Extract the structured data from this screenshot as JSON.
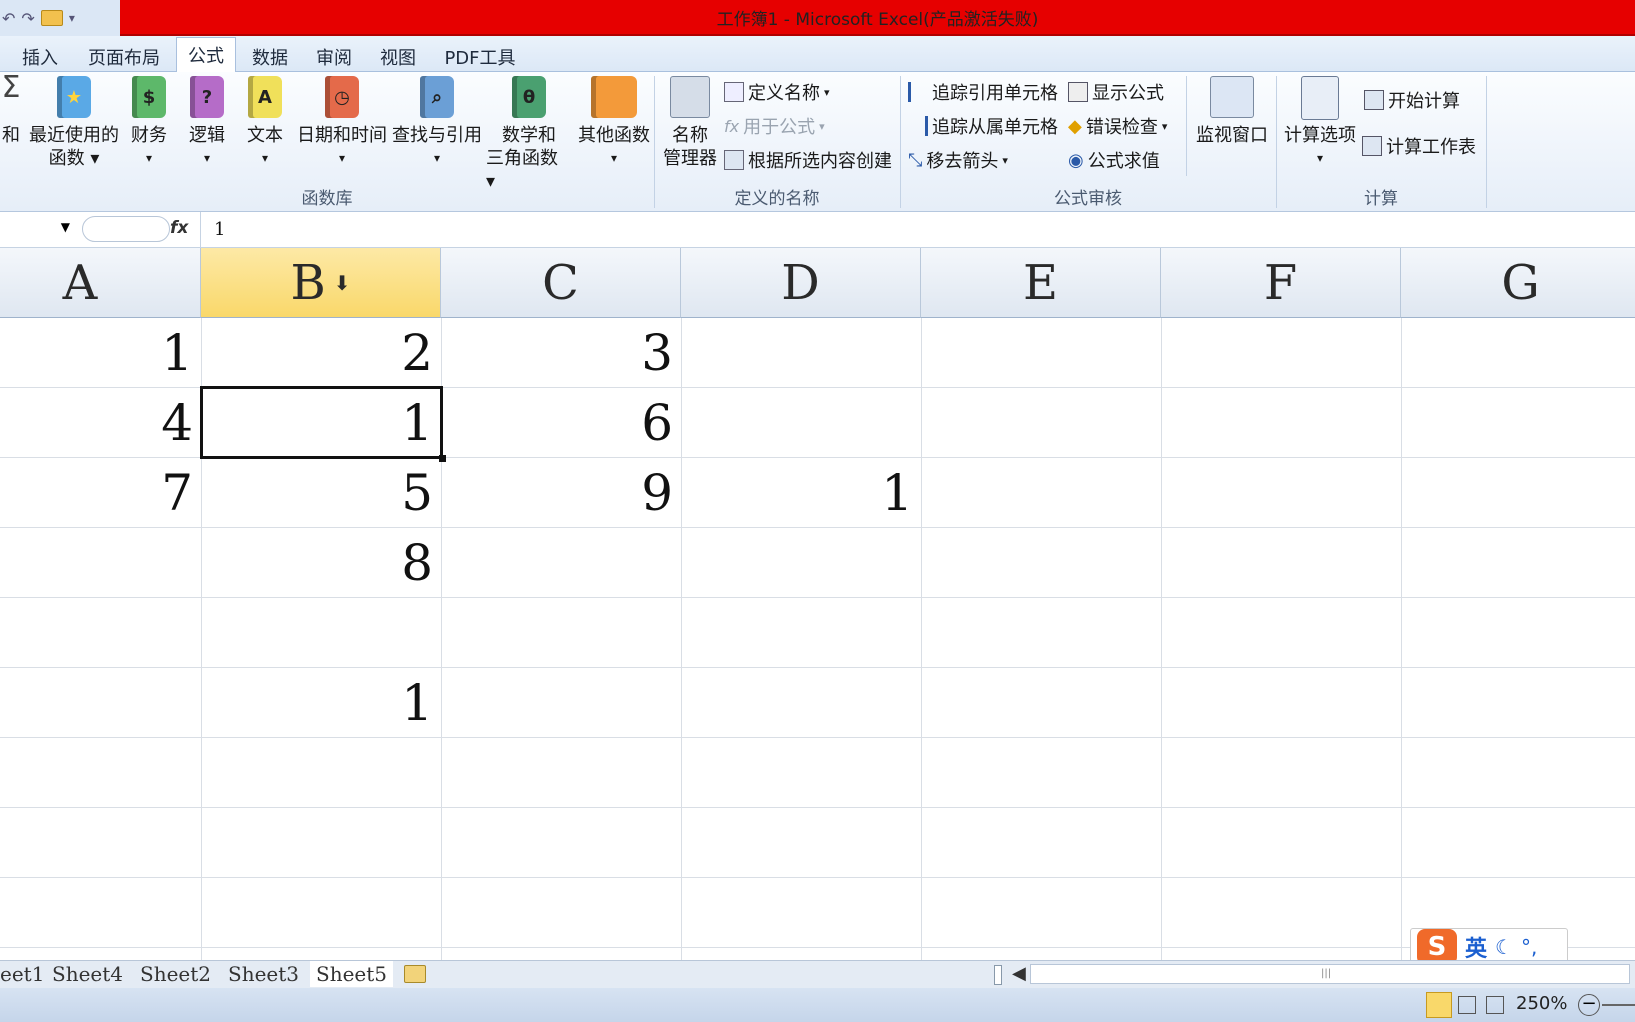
{
  "window": {
    "title": "工作簿1 - Microsoft Excel(产品激活失败)"
  },
  "tabs": [
    {
      "label": "插入"
    },
    {
      "label": "页面布局"
    },
    {
      "label": "公式"
    },
    {
      "label": "数据"
    },
    {
      "label": "审阅"
    },
    {
      "label": "视图"
    },
    {
      "label": "PDF工具"
    }
  ],
  "ribbon": {
    "function_library": {
      "label": "函数库",
      "autosum_partial": "和",
      "recent_line1": "最近使用的",
      "recent_line2": "函数",
      "financial": "财务",
      "logical": "逻辑",
      "text": "文本",
      "datetime": "日期和时间",
      "lookup": "查找与引用",
      "math_line1": "数学和",
      "math_line2": "三角函数",
      "more": "其他函数"
    },
    "defined_names": {
      "label": "定义的名称",
      "name_manager_line1": "名称",
      "name_manager_line2": "管理器",
      "define_name": "定义名称",
      "use_in_formula": "用于公式",
      "create_from_selection": "根据所选内容创建"
    },
    "auditing": {
      "label": "公式审核",
      "trace_precedents": "追踪引用单元格",
      "trace_dependents": "追踪从属单元格",
      "remove_arrows": "移去箭头",
      "show_formulas": "显示公式",
      "error_checking": "错误检查",
      "evaluate_formula": "公式求值",
      "watch_window": "监视窗口"
    },
    "calculation": {
      "label": "计算",
      "options": "计算选项",
      "calc_now": "开始计算",
      "calc_sheet": "计算工作表"
    }
  },
  "formula_bar": {
    "fx": "fx",
    "value": "1"
  },
  "columns": [
    "A",
    "B",
    "C",
    "D",
    "E",
    "F",
    "G"
  ],
  "cells": {
    "r1": {
      "A": "1",
      "B": "2",
      "C": "3"
    },
    "r2": {
      "A": "4",
      "B": "1",
      "C": "6"
    },
    "r3": {
      "A": "7",
      "B": "5",
      "C": "9",
      "D": "1"
    },
    "r4": {
      "B": "8"
    },
    "r6": {
      "B": "1"
    }
  },
  "sheets": [
    {
      "name": "eet1"
    },
    {
      "name": "Sheet4"
    },
    {
      "name": "Sheet2"
    },
    {
      "name": "Sheet3"
    },
    {
      "name": "Sheet5"
    }
  ],
  "status": {
    "zoom": "250%"
  },
  "ime": {
    "mode": "英"
  },
  "colors": {
    "title_bar": "#e60000",
    "selected_header": "#f9d86a",
    "grid_line": "#d9dee5"
  }
}
